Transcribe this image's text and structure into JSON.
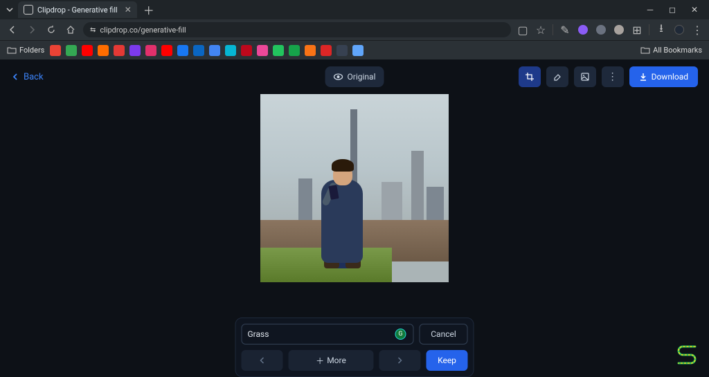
{
  "browser": {
    "tab_title": "Clipdrop - Generative fill",
    "url": "clipdrop.co/generative-fill",
    "folders_label": "Folders",
    "all_bookmarks_label": "All Bookmarks",
    "bookmark_icons": [
      {
        "name": "gmail",
        "bg": "#ea4335"
      },
      {
        "name": "drive",
        "bg": "#34a853"
      },
      {
        "name": "youtube-red",
        "bg": "#ff0000"
      },
      {
        "name": "app-orange",
        "bg": "#ff6d00"
      },
      {
        "name": "app-red",
        "bg": "#e53935"
      },
      {
        "name": "app-purple",
        "bg": "#7c3aed"
      },
      {
        "name": "instagram",
        "bg": "#e1306c"
      },
      {
        "name": "youtube",
        "bg": "#ff0000"
      },
      {
        "name": "facebook",
        "bg": "#1877f2"
      },
      {
        "name": "linkedin",
        "bg": "#0a66c2"
      },
      {
        "name": "app-blue",
        "bg": "#4285f4"
      },
      {
        "name": "app-teal",
        "bg": "#06b6d4"
      },
      {
        "name": "pinterest",
        "bg": "#bd081c"
      },
      {
        "name": "app-pink",
        "bg": "#ec4899"
      },
      {
        "name": "app-green",
        "bg": "#22c55e"
      },
      {
        "name": "app-green2",
        "bg": "#16a34a"
      },
      {
        "name": "app-orange2",
        "bg": "#f97316"
      },
      {
        "name": "app-red2",
        "bg": "#dc2626"
      },
      {
        "name": "app-dark",
        "bg": "#374151"
      },
      {
        "name": "sparkle",
        "bg": "#60a5fa"
      }
    ]
  },
  "app": {
    "back_label": "Back",
    "original_label": "Original",
    "download_label": "Download",
    "prompt_value": "Grass",
    "cancel_label": "Cancel",
    "more_label": "More",
    "keep_label": "Keep"
  }
}
